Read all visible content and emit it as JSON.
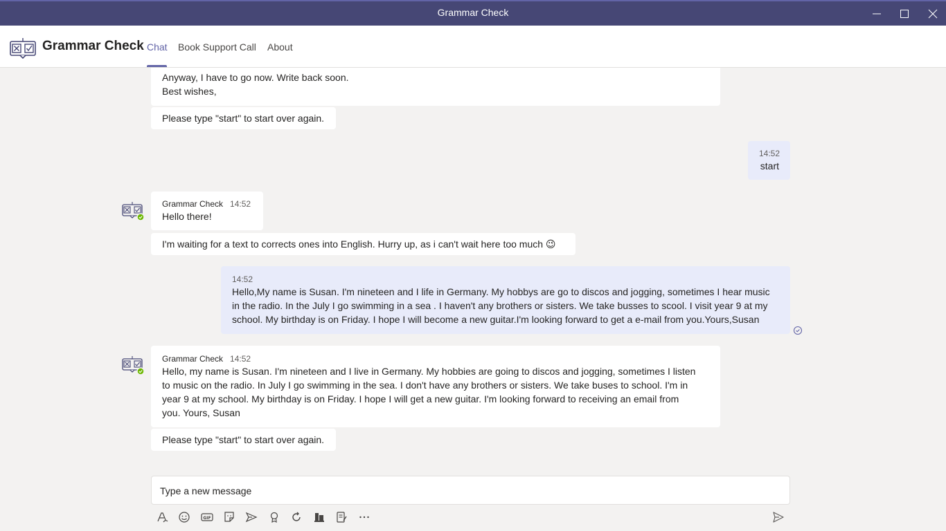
{
  "window": {
    "title": "Grammar Check",
    "controls": {
      "minimize_icon": "minimize-icon",
      "maximize_icon": "maximize-icon",
      "close_icon": "close-icon"
    }
  },
  "header": {
    "app_name": "Grammar Check",
    "tabs": [
      {
        "label": "Chat",
        "active": true
      },
      {
        "label": "Book Support Call",
        "active": false
      },
      {
        "label": "About",
        "active": false
      }
    ]
  },
  "colors": {
    "titlebar": "#464775",
    "accent": "#6264a7",
    "my_message_bg": "#e8ebfa",
    "bot_status": "#6bb700"
  },
  "messages": [
    {
      "from": "bot",
      "lines": [
        "Anyway, I have to go now. Write back soon.",
        "Best wishes,"
      ]
    },
    {
      "from": "bot",
      "text": "Please type \"start\" to start over again."
    },
    {
      "from": "me",
      "time": "14:52",
      "text": "start"
    },
    {
      "from": "bot",
      "sender": "Grammar Check",
      "time": "14:52",
      "text": "Hello there!"
    },
    {
      "from": "bot",
      "text": "I'm waiting for a text to corrects ones into English. Hurry up, as i can't wait here too much 😉"
    },
    {
      "from": "me",
      "time": "14:52",
      "lines": [
        "Hello,My name is Susan. I'm nineteen and I life in Germany. My hobbys are go to discos and jogging, sometimes I hear music",
        "in the radio. In the July I go swimming in a sea . I haven't any brothers or sisters. We take busses to scool. I visit year 9 at my",
        "school. My birthday is on Friday. I hope I will become a new guitar.I'm looking forward to get a e-mail from you.Yours,Susan"
      ]
    },
    {
      "from": "bot",
      "sender": "Grammar Check",
      "time": "14:52",
      "lines": [
        "Hello, my name is Susan. I'm nineteen and I live in Germany. My hobbies are going to discos and jogging, sometimes I listen",
        "to music on the radio. In July I go swimming in the sea. I don't have any brothers or sisters. We take buses to school. I'm in",
        "year 9 at my school. My birthday is on Friday. I hope I will get a new guitar. I'm looking forward to receiving an email from",
        "you. Yours, Susan"
      ]
    },
    {
      "from": "bot",
      "text": "Please type \"start\" to start over again."
    }
  ],
  "compose": {
    "placeholder": "Type a new message",
    "toolbar_icons": [
      "format-icon",
      "emoji-icon",
      "gif-icon",
      "sticker-icon",
      "meet-now-icon",
      "praise-icon",
      "loop-icon",
      "app-icon",
      "notes-icon",
      "more-options-icon"
    ],
    "send_icon": "send-icon"
  }
}
